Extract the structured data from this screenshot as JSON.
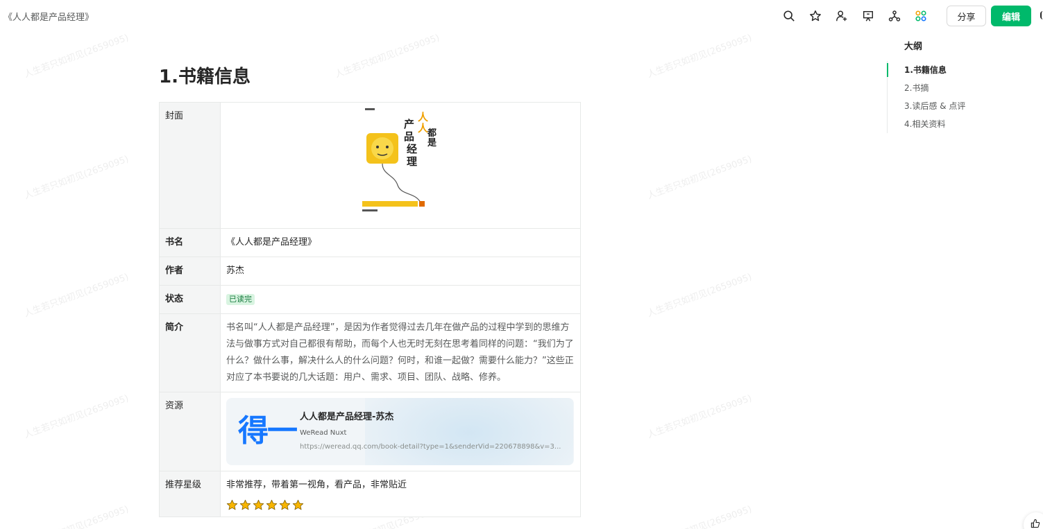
{
  "header": {
    "doc_title": "《人人都是产品经理》",
    "tools": [
      "search-icon",
      "star-icon",
      "add-member-icon",
      "presentation-icon",
      "graph-icon",
      "apps-icon"
    ],
    "share_label": "分享",
    "edit_label": "编辑"
  },
  "watermark": "人生若只如初见(2659095)",
  "content": {
    "heading": "1.书籍信息",
    "rows": {
      "cover": {
        "label": "封面",
        "book_title_art": "人人都是产品经理"
      },
      "name": {
        "label": "书名",
        "value": "《人人都是产品经理》"
      },
      "author": {
        "label": "作者",
        "value": "苏杰"
      },
      "status": {
        "label": "状态",
        "value": "已读完"
      },
      "intro": {
        "label": "简介",
        "value": "书名叫“人人都是产品经理”，是因为作者觉得过去几年在做产品的过程中学到的思维方法与做事方式对自己都很有帮助，而每个人也无时无刻在思考着同样的问题：“我们为了什么？做什么事，解决什么人的什么问题？何时，和谁一起做？需要什么能力？”这些正对应了本书要说的几大话题：用户、需求、项目、团队、战略、修养。"
      },
      "resource": {
        "label": "资源",
        "logo_text": "得一",
        "title": "人人都是产品经理-苏杰",
        "site": "WeRead Nuxt",
        "url": "https://weread.qq.com/book-detail?type=1&senderVid=220678898&v=3..."
      },
      "rating": {
        "label": "推荐星级",
        "comment": "非常推荐，带着第一视角，看产品，非常贴近",
        "stars": 6
      }
    }
  },
  "outline": {
    "title": "大纲",
    "items": [
      {
        "label": "1.书籍信息",
        "active": true
      },
      {
        "label": "2.书摘",
        "active": false
      },
      {
        "label": "3.读后感 & 点评",
        "active": false
      },
      {
        "label": "4.相关资料",
        "active": false
      }
    ]
  },
  "colors": {
    "brand_green": "#00b96b",
    "status_badge_bg": "#d9f4e1",
    "star": "#f7b500",
    "resource_logo": "#1677ff"
  }
}
